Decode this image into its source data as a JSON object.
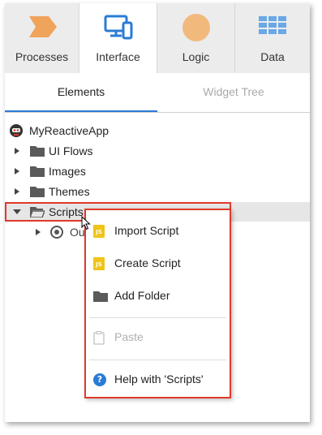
{
  "top_tabs": [
    {
      "label": "Processes",
      "icon": "chevron-process-icon",
      "active": false
    },
    {
      "label": "Interface",
      "icon": "devices-icon",
      "active": true
    },
    {
      "label": "Logic",
      "icon": "circle-logic-icon",
      "active": false
    },
    {
      "label": "Data",
      "icon": "table-grid-icon",
      "active": false
    }
  ],
  "sub_tabs": [
    {
      "label": "Elements",
      "active": true
    },
    {
      "label": "Widget Tree",
      "active": false
    }
  ],
  "tree": {
    "root": {
      "label": "MyReactiveApp",
      "icon": "app-logo-icon"
    },
    "items": [
      {
        "label": "UI Flows",
        "expanded": false
      },
      {
        "label": "Images",
        "expanded": false
      },
      {
        "label": "Themes",
        "expanded": false
      },
      {
        "label": "Scripts",
        "expanded": true,
        "selected": true
      },
      {
        "label": "Ou",
        "icon": "target-icon",
        "expanded": false
      }
    ]
  },
  "context_menu": {
    "items": [
      {
        "label": "Import Script",
        "icon": "js-file-icon",
        "enabled": true
      },
      {
        "label": "Create Script",
        "icon": "js-file-icon",
        "enabled": true
      },
      {
        "label": "Add Folder",
        "icon": "folder-icon",
        "enabled": true
      },
      {
        "label": "Paste",
        "icon": "clipboard-icon",
        "enabled": false
      },
      {
        "label": "Help with 'Scripts'",
        "icon": "help-icon",
        "enabled": true
      }
    ],
    "js_badge": "JS",
    "help_glyph": "?"
  },
  "colors": {
    "accent": "#2b7bd5",
    "highlight_border": "#e0392b",
    "process_orange": "#f0a35b",
    "logic_orange": "#f2b97d",
    "data_blue": "#6aa8e6",
    "js_yellow": "#f0c419",
    "folder_gray": "#5a5a5a"
  }
}
